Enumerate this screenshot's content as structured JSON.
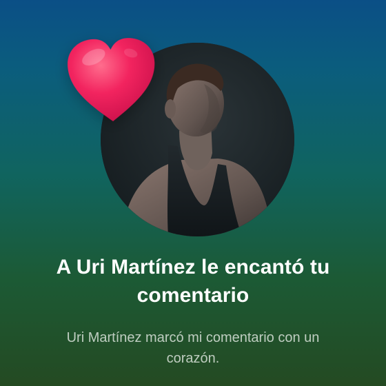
{
  "notification": {
    "title": "A Uri Martínez le encantó tu comentario",
    "subtitle": "Uri Martínez marcó mi comentario con un corazón."
  },
  "icons": {
    "reaction": "heart-icon"
  },
  "colors": {
    "background_top": "#0b4f86",
    "background_bottom": "#244a22",
    "heart": "#f2245f",
    "title_text": "#ffffff",
    "subtitle_text": "#d7dfd6"
  }
}
